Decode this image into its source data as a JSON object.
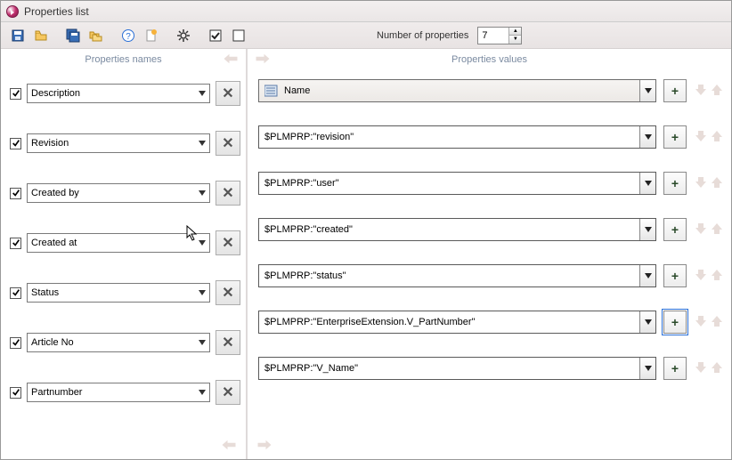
{
  "window": {
    "title": "Properties list"
  },
  "toolbar": {
    "number_label": "Number of properties",
    "number_value": "7"
  },
  "headers": {
    "names": "Properties names",
    "values": "Properties values"
  },
  "rows": [
    {
      "checked": true,
      "name": "Description",
      "value_label": "Name",
      "value_is_icon": true
    },
    {
      "checked": true,
      "name": "Revision",
      "value_label": "$PLMPRP:\"revision\"",
      "value_is_icon": false
    },
    {
      "checked": true,
      "name": "Created by",
      "value_label": "$PLMPRP:\"user\"",
      "value_is_icon": false
    },
    {
      "checked": true,
      "name": "Created at",
      "value_label": "$PLMPRP:\"created\"",
      "value_is_icon": false
    },
    {
      "checked": true,
      "name": "Status",
      "value_label": "$PLMPRP:\"status\"",
      "value_is_icon": false
    },
    {
      "checked": true,
      "name": "Article No",
      "value_label": "$PLMPRP:\"EnterpriseExtension.V_PartNumber\"",
      "value_is_icon": false,
      "plus_focused": true
    },
    {
      "checked": true,
      "name": "Partnumber",
      "value_label": "$PLMPRP:\"V_Name\"",
      "value_is_icon": false
    }
  ],
  "icons": {
    "plus": "+",
    "times": "✕"
  },
  "cursor": {
    "row": 3
  }
}
